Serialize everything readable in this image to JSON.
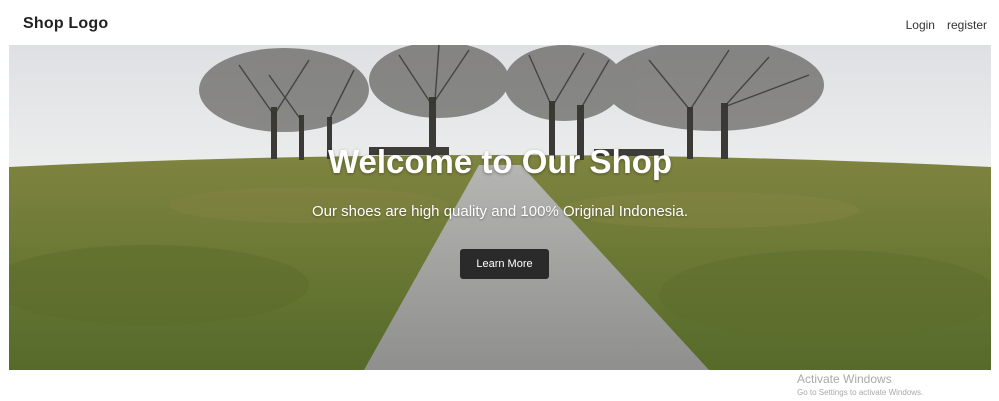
{
  "navbar": {
    "logo": "Shop Logo",
    "links": [
      "Login",
      "register"
    ]
  },
  "hero": {
    "title": "Welcome to Our Shop",
    "subtitle": "Our shoes are high quality and 100% Original Indonesia.",
    "button_label": "Learn More",
    "background": "landscape photo of a gravel path through a grassy field with bare trees",
    "colors": {
      "sky": "#e8e9eb",
      "grass": "#6f7a36",
      "path": "#9d9d9b",
      "trees": "#3b3a36",
      "button": "#2a2a2a"
    }
  },
  "watermark": {
    "title": "Activate Windows",
    "subtitle": "Go to Settings to activate Windows."
  }
}
